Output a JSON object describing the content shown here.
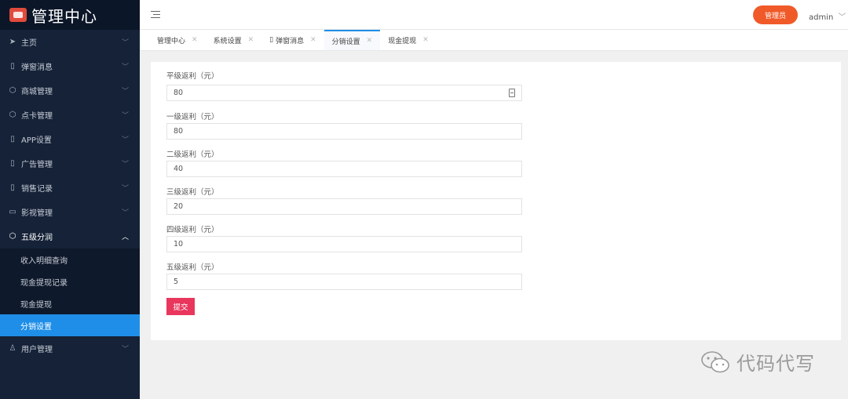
{
  "sidebar": {
    "brand_title": "管理中心",
    "items": [
      {
        "label": "主页",
        "icon": "send-icon"
      },
      {
        "label": "弹窗消息",
        "icon": "doc-icon"
      },
      {
        "label": "商城管理",
        "icon": "cube-icon"
      },
      {
        "label": "点卡管理",
        "icon": "cube-icon"
      },
      {
        "label": "APP设置",
        "icon": "doc-icon"
      },
      {
        "label": "广告管理",
        "icon": "doc-icon"
      },
      {
        "label": "销售记录",
        "icon": "doc-icon"
      },
      {
        "label": "影视管理",
        "icon": "video-icon"
      },
      {
        "label": "五级分润",
        "icon": "cube-icon"
      }
    ],
    "subitems": [
      "收入明细查询",
      "现金提现记录",
      "现金提现",
      "分销设置"
    ],
    "active_subitem": "分销设置",
    "last_item": {
      "label": "用户管理",
      "icon": "user-icon"
    }
  },
  "topbar": {
    "admin_button": "管理员",
    "username": "admin"
  },
  "tabs": [
    {
      "label": "管理中心"
    },
    {
      "label": "系统设置"
    },
    {
      "label": "弹窗消息"
    },
    {
      "label": "分销设置"
    },
    {
      "label": "现金提现"
    }
  ],
  "active_tab": "分销设置",
  "form": {
    "fields": [
      {
        "label": "平级返利（元）",
        "value": "80"
      },
      {
        "label": "一级返利（元）",
        "value": "80"
      },
      {
        "label": "二级返利（元）",
        "value": "40"
      },
      {
        "label": "三级返利（元）",
        "value": "20"
      },
      {
        "label": "四级返利（元）",
        "value": "10"
      },
      {
        "label": "五级返利（元）",
        "value": "5"
      }
    ],
    "submit_label": "提交"
  },
  "watermark": {
    "text": "代码代写"
  },
  "colors": {
    "sidebar_bg": "#152238",
    "accent_blue": "#1f8ee8",
    "admin_orange": "#f05a28",
    "submit_red": "#e8365d"
  }
}
